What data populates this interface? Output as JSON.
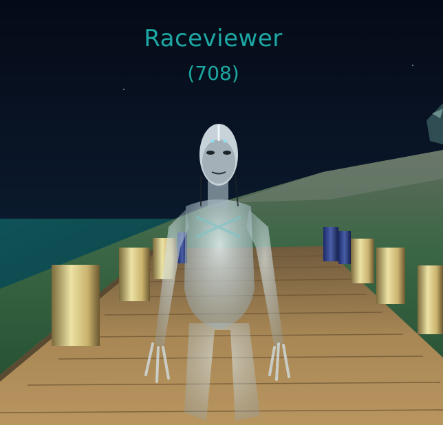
{
  "nameplate": {
    "name": "Raceviewer",
    "id": "(708)"
  },
  "colors": {
    "sky": "#060d1e",
    "water": "#0c4148",
    "grass": "#2e5a3a",
    "dock": "#a98652",
    "nameplate_text": "#1fa6a6"
  }
}
